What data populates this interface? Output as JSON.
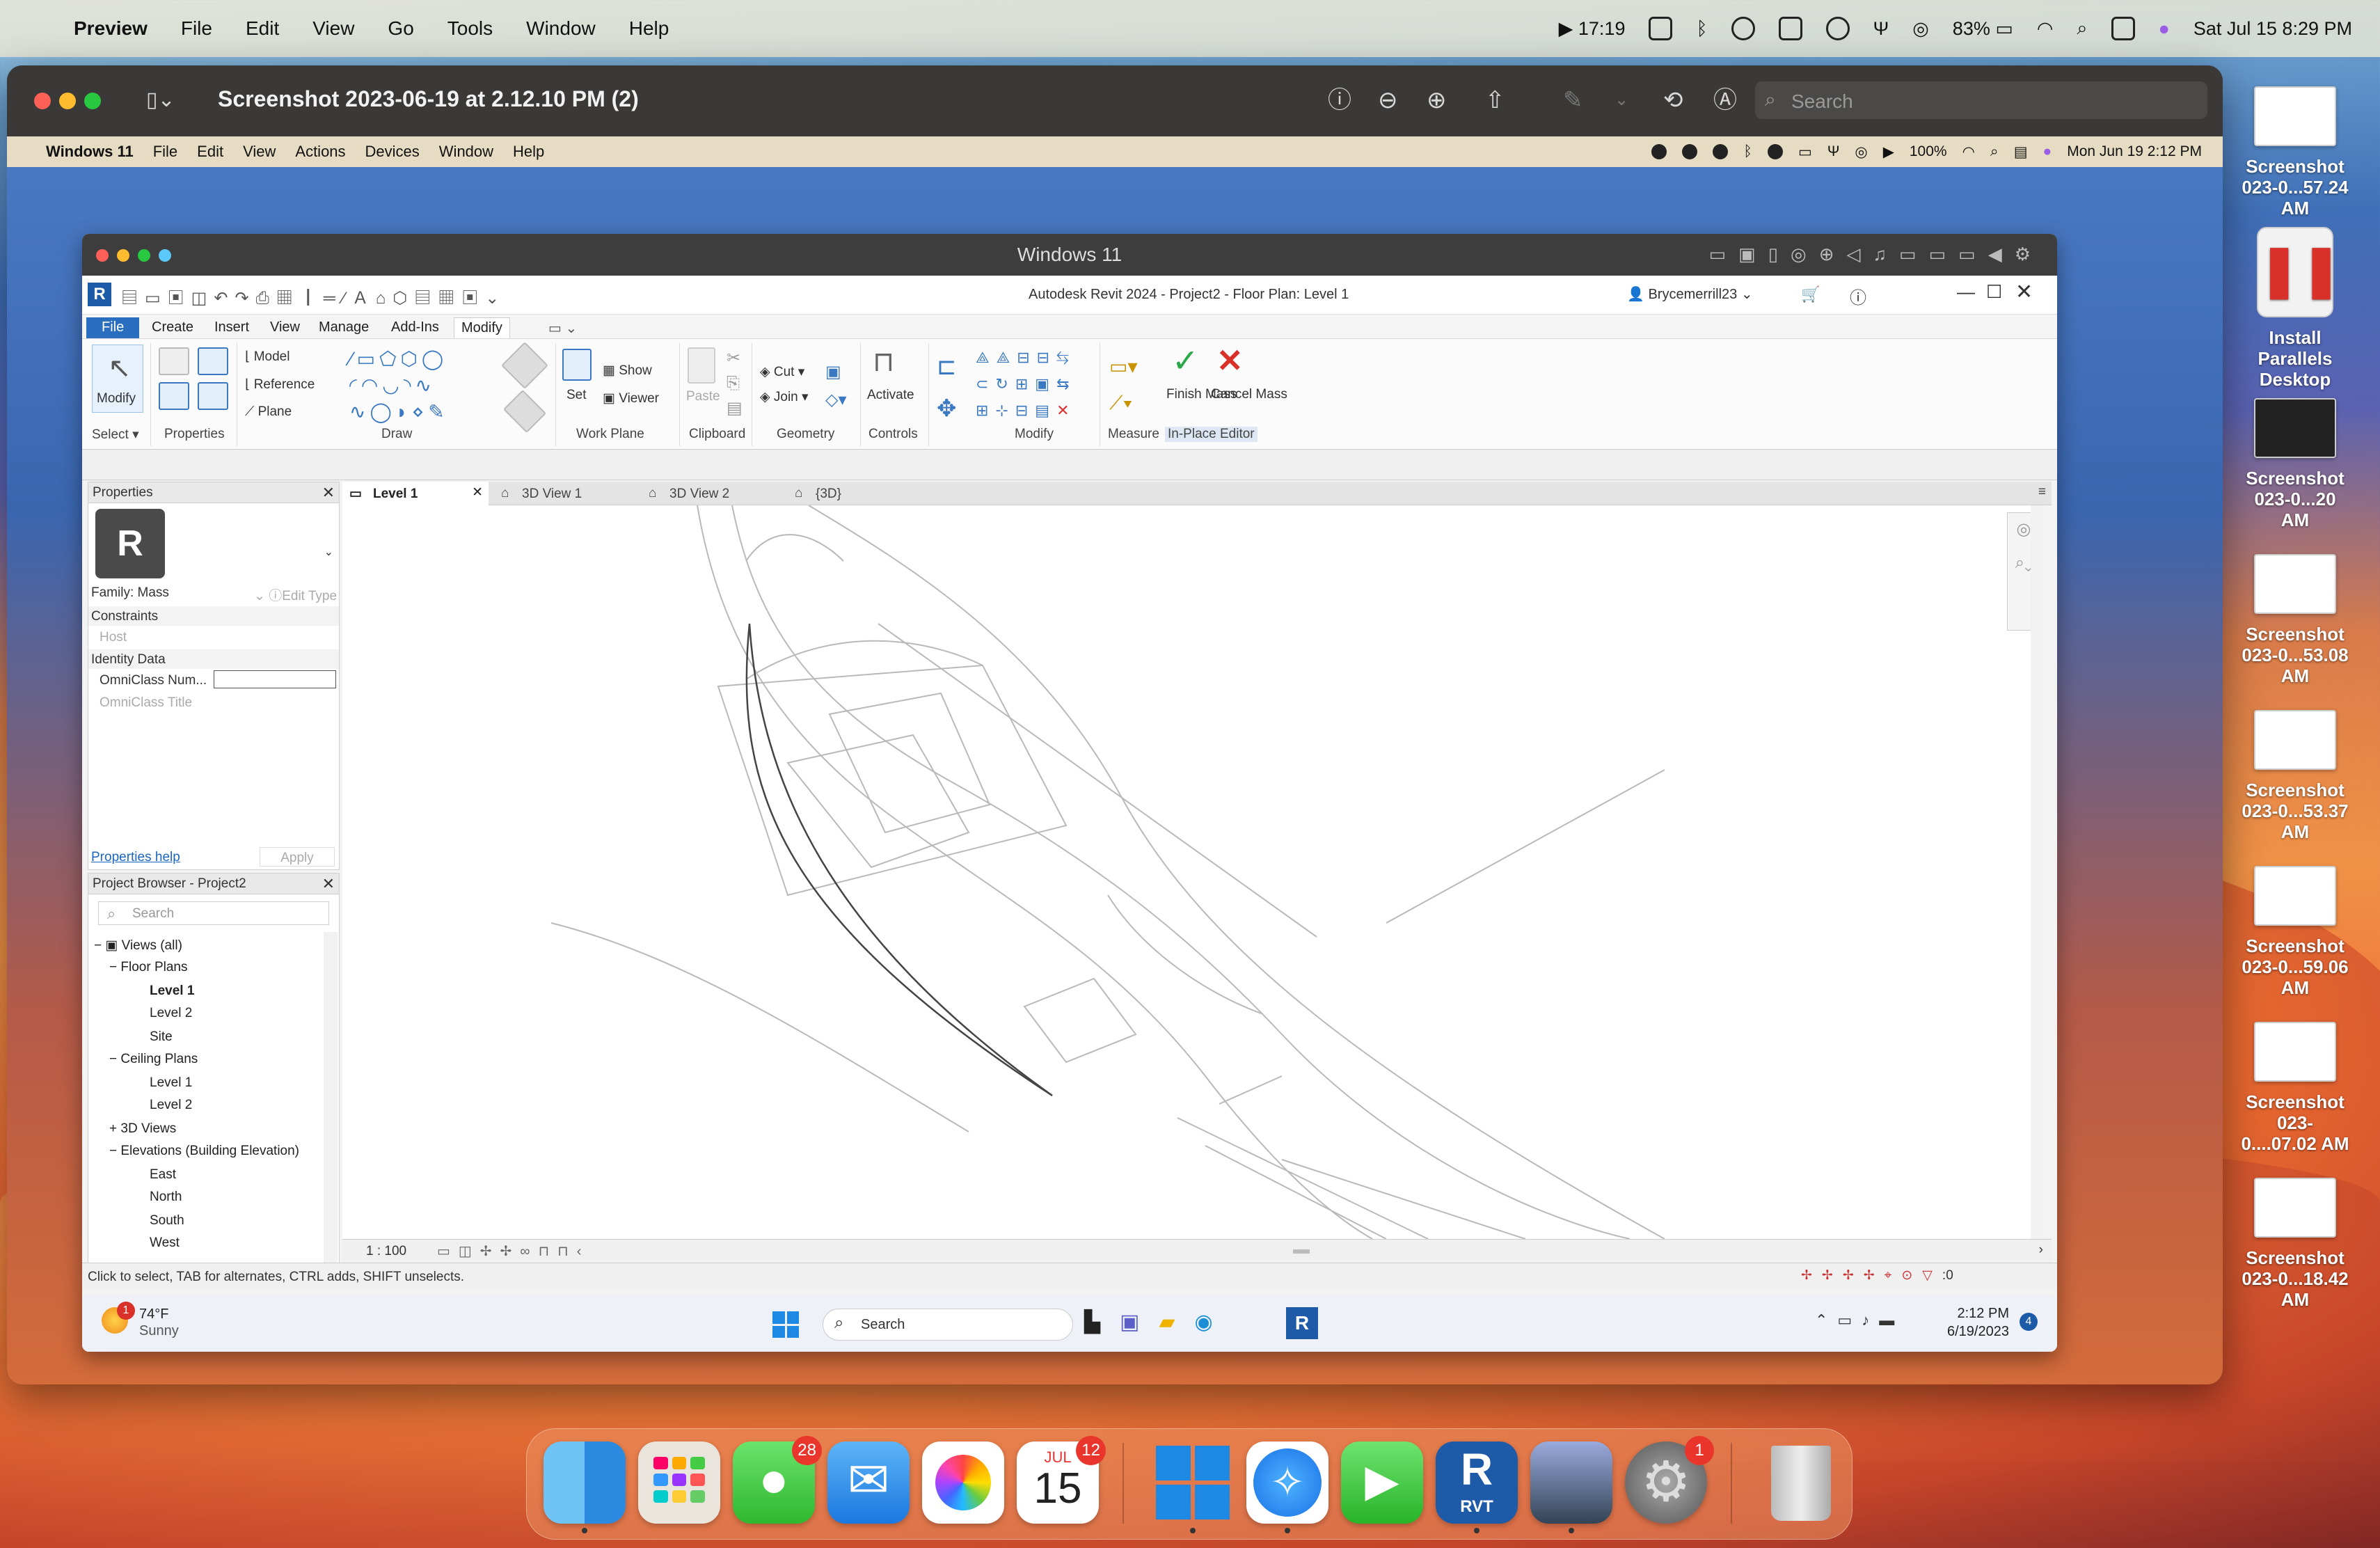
{
  "mac_menubar": {
    "app": "Preview",
    "items": [
      "File",
      "Edit",
      "View",
      "Go",
      "Tools",
      "Window",
      "Help"
    ],
    "timer": "17:19",
    "battery": "83%",
    "datetime": "Sat Jul 15  8:29 PM"
  },
  "preview": {
    "title": "Screenshot 2023-06-19 at 2.12.10 PM (2)",
    "search_placeholder": "Search"
  },
  "win_menubar": {
    "app": "Windows 11",
    "items": [
      "File",
      "Edit",
      "View",
      "Actions",
      "Devices",
      "Window",
      "Help"
    ],
    "battery": "100%",
    "datetime": "Mon Jun 19  2:12 PM"
  },
  "parallels": {
    "title": "Windows 11"
  },
  "revit": {
    "title": "Autodesk Revit 2024 - Project2 - Floor Plan: Level 1",
    "user": "Brycemerrill23",
    "tabs": [
      "File",
      "Create",
      "Insert",
      "View",
      "Manage",
      "Add-Ins",
      "Modify"
    ],
    "ribbon": {
      "modify": "Modify",
      "select": "Select",
      "properties": "Properties",
      "model": "Model",
      "reference": "Reference",
      "plane": "Plane",
      "draw": "Draw",
      "set": "Set",
      "show": "Show",
      "viewer": "Viewer",
      "work_plane": "Work Plane",
      "paste": "Paste",
      "clipboard": "Clipboard",
      "cut": "Cut",
      "join": "Join",
      "geometry": "Geometry",
      "activate": "Activate",
      "controls": "Controls",
      "modify_grp": "Modify",
      "measure": "Measure",
      "finish_mass": "Finish Mass",
      "cancel_mass": "Cancel Mass",
      "in_place_editor": "In-Place Editor"
    },
    "properties": {
      "header": "Properties",
      "family": "Family: Mass",
      "edit_type": "Edit Type",
      "constraints": "Constraints",
      "host": "Host",
      "identity": "Identity Data",
      "omni_num": "OmniClass Num...",
      "omni_title": "OmniClass Title",
      "help": "Properties help",
      "apply": "Apply"
    },
    "browser": {
      "header": "Project Browser - Project2",
      "search": "Search",
      "views_all": "Views (all)",
      "floor_plans": "Floor Plans",
      "fp": [
        "Level 1",
        "Level 2",
        "Site"
      ],
      "ceiling_plans": "Ceiling Plans",
      "cp": [
        "Level 1",
        "Level 2"
      ],
      "views3d": "3D Views",
      "elev": "Elevations (Building Elevation)",
      "ev": [
        "East",
        "North",
        "South",
        "West"
      ]
    },
    "view_tabs": [
      "Level 1",
      "3D View 1",
      "3D View 2",
      "{3D}"
    ],
    "scale": "1 : 100",
    "status": "Click to select, TAB for alternates, CTRL adds, SHIFT unselects.",
    "filter_count": ":0"
  },
  "taskbar": {
    "temp": "74°F",
    "weather": "Sunny",
    "search": "Search",
    "time": "2:12 PM",
    "date": "6/19/2023",
    "notif": "4",
    "weather_badge": "1"
  },
  "desktop": [
    {
      "line1": "Screenshot",
      "line2": "023-0...57.24 AM"
    },
    {
      "line1": "Install Parallels",
      "line2": "Desktop"
    },
    {
      "line1": "Screenshot",
      "line2": "023-0...20 AM"
    },
    {
      "line1": "Screenshot",
      "line2": "023-0...53.08 AM"
    },
    {
      "line1": "Screenshot",
      "line2": "023-0...53.37 AM"
    },
    {
      "line1": "Screenshot",
      "line2": "023-0...59.06 AM"
    },
    {
      "line1": "Screenshot",
      "line2": "023-0....07.02 AM"
    },
    {
      "line1": "Screenshot",
      "line2": "023-0...18.42 AM"
    }
  ],
  "dock": {
    "messages_badge": "28",
    "calendar_month": "JUL",
    "calendar_day": "15",
    "calendar_badge": "12",
    "settings_badge": "1",
    "rvt_label": "RVT"
  }
}
